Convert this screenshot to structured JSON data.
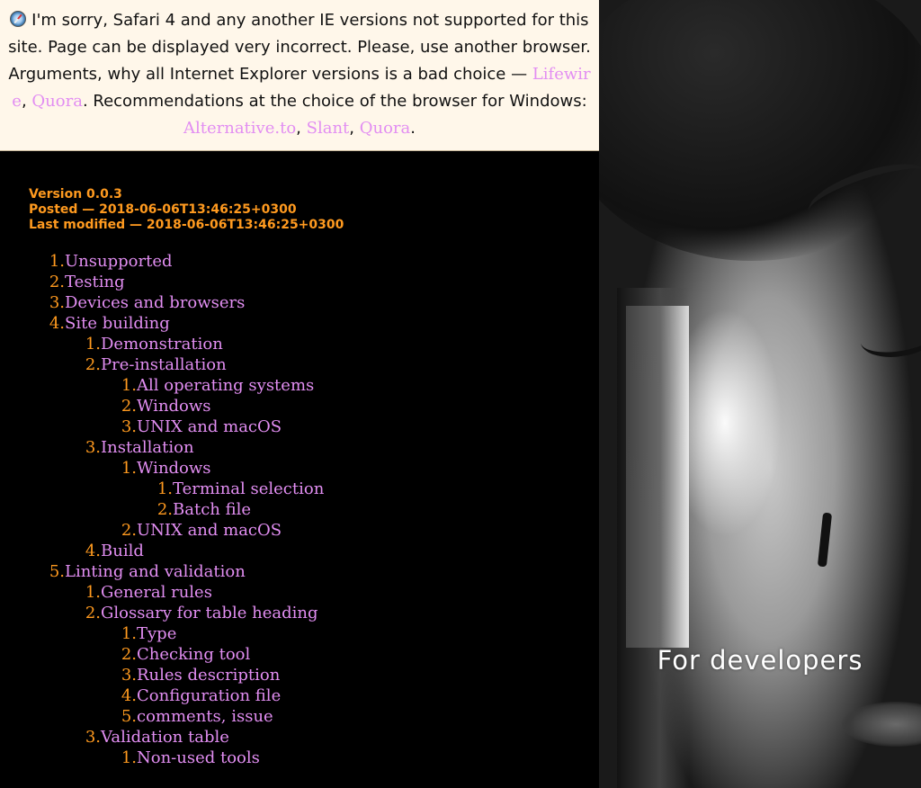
{
  "warning": {
    "icon": "safari-icon",
    "text_before": "I'm sorry, Safari 4 and any another IE versions not supported for this site. Page can be displayed very incorrect. Please, use another browser. Arguments, why all Internet Explorer versions is a bad choice — ",
    "link_lifewire": "Lifewire",
    "comma1": ", ",
    "link_quora1": "Quora",
    "text_middle": ". Recommendations at the choice of the browser for Windows: ",
    "link_alternative": "Alternative.to",
    "comma2": ", ",
    "link_slant": "Slant",
    "comma3": ", ",
    "link_quora2": "Quora",
    "text_end": "."
  },
  "meta": {
    "version": "Version 0.0.3",
    "posted": "Posted — 2018-06-06T13:46:25+0300",
    "modified": "Last modified — 2018-06-06T13:46:25+0300"
  },
  "toc": [
    {
      "num": "1.",
      "label": "Unsupported",
      "level": 0
    },
    {
      "num": "2.",
      "label": "Testing",
      "level": 0
    },
    {
      "num": "3.",
      "label": "Devices and browsers",
      "level": 0
    },
    {
      "num": "4.",
      "label": "Site building",
      "level": 0
    },
    {
      "num": "1.",
      "label": "Demonstration",
      "level": 1
    },
    {
      "num": "2.",
      "label": "Pre-installation",
      "level": 1
    },
    {
      "num": "1.",
      "label": "All operating systems",
      "level": 2
    },
    {
      "num": "2.",
      "label": "Windows",
      "level": 2
    },
    {
      "num": "3.",
      "label": "UNIX and macOS",
      "level": 2
    },
    {
      "num": "3.",
      "label": "Installation",
      "level": 1
    },
    {
      "num": "1.",
      "label": "Windows",
      "level": 2
    },
    {
      "num": "1.",
      "label": "Terminal selection",
      "level": 3
    },
    {
      "num": "2.",
      "label": "Batch file",
      "level": 3
    },
    {
      "num": "2.",
      "label": "UNIX and macOS",
      "level": 2
    },
    {
      "num": "4.",
      "label": "Build",
      "level": 1
    },
    {
      "num": "5.",
      "label": "Linting and validation",
      "level": 0
    },
    {
      "num": "1.",
      "label": "General rules",
      "level": 1
    },
    {
      "num": "2.",
      "label": "Glossary for table heading",
      "level": 1
    },
    {
      "num": "1.",
      "label": "Type",
      "level": 2
    },
    {
      "num": "2.",
      "label": "Checking tool",
      "level": 2
    },
    {
      "num": "3.",
      "label": "Rules description",
      "level": 2
    },
    {
      "num": "4.",
      "label": "Configuration file",
      "level": 2
    },
    {
      "num": "5.",
      "label": "comments, issue",
      "level": 2
    },
    {
      "num": "3.",
      "label": "Validation table",
      "level": 1
    },
    {
      "num": "1.",
      "label": "Non-used tools",
      "level": 2
    }
  ],
  "hero": {
    "caption": "For developers"
  },
  "colors": {
    "link": "#e28ef2",
    "accent": "#ff9a1f",
    "warning_bg": "#fff7ea"
  }
}
